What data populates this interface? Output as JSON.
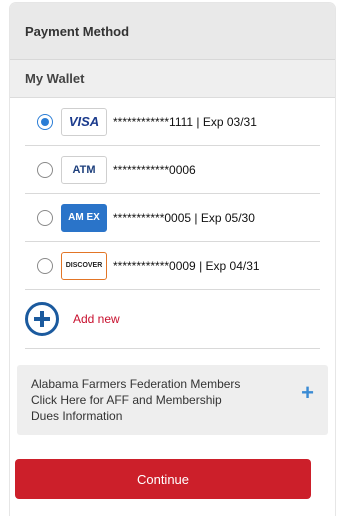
{
  "header": {
    "title": "Payment Method"
  },
  "wallet": {
    "title": "My Wallet",
    "cards": [
      {
        "brand": "VISA",
        "icon": "visa-card-icon",
        "text": "************1111 | Exp 03/31",
        "selected": true
      },
      {
        "brand": "ATM",
        "icon": "atm-card-icon",
        "text": "************0006",
        "selected": false
      },
      {
        "brand": "AM EX",
        "icon": "amex-card-icon",
        "text": "***********0005 | Exp 05/30",
        "selected": false
      },
      {
        "brand": "DISCOVER",
        "icon": "discover-card-icon",
        "text": "************0009 | Exp 04/31",
        "selected": false
      }
    ],
    "add_new_label": "Add new"
  },
  "aff_banner": {
    "text": "Alabama Farmers Federation Members Click Here for AFF and Membership Dues Information"
  },
  "continue_label": "Continue",
  "colors": {
    "accent_blue": "#2a7dd6",
    "continue_red": "#cc1f2a",
    "add_new_red": "#c8102e"
  }
}
